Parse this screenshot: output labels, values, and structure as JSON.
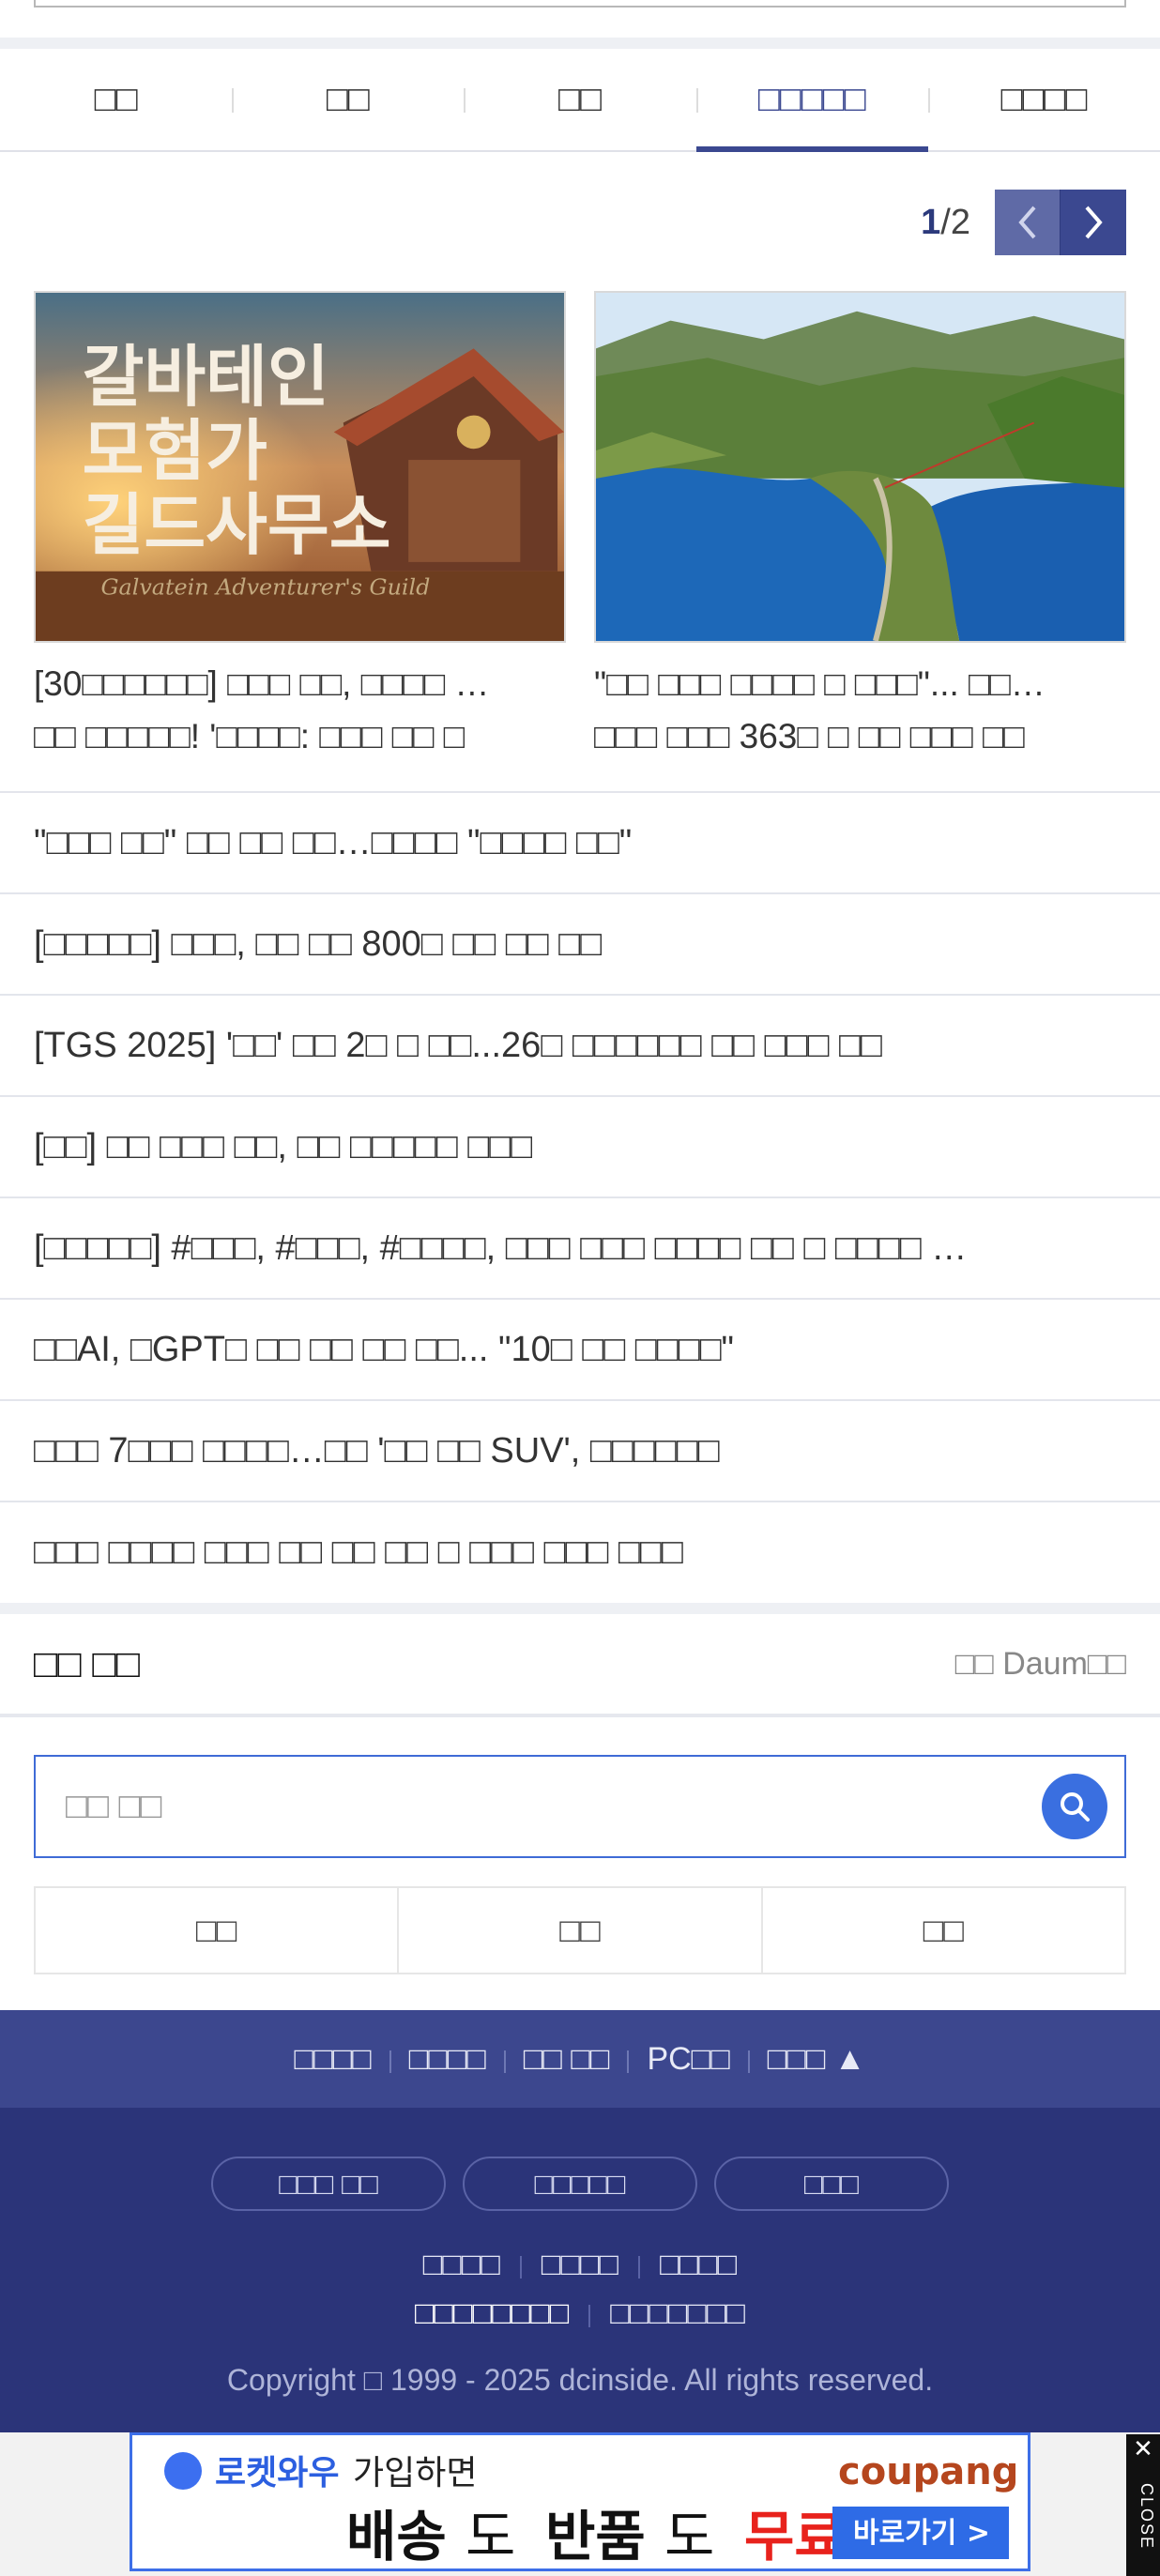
{
  "tabs": [
    {
      "label": "□□"
    },
    {
      "label": "□□"
    },
    {
      "label": "□□"
    },
    {
      "label": "□□□□□"
    },
    {
      "label": "□□□□"
    }
  ],
  "pager": {
    "current": "1",
    "total": "/2"
  },
  "cards": [
    {
      "title": "[30□□□□□□] □□□ □□, □□□□ …",
      "subtitle": "□□ □□□□□! '□□□□: □□□ □□ □",
      "image": {
        "text_lines": [
          "갈바테인",
          "모험가",
          "길드사무소"
        ],
        "script": "Galvatein Adventurer's Guild"
      }
    },
    {
      "title": "\"□□ □□□ □□□□ □ □□□\"... □□…",
      "subtitle": "□□□ □□□ 363□ □ □□ □□□ □□"
    }
  ],
  "list": [
    "\"□□□ □□\" □□ □□ □□…□□□□ \"□□□□ □□\"",
    "[□□□□□] □□□, □□ □□ 800□ □□ □□ □□",
    "[TGS 2025] '□□' □□ 2□ □ □□...26□ □□□□□□ □□ □□□ □□",
    "[□□] □□ □□□ □□, □□ □□□□□ □□□",
    "[□□□□□] #□□□, #□□□, #□□□□, □□□ □□□ □□□□ □□ □ □□□□ …",
    "□□AI, □GPT□ □□ □□ □□ □□... \"10□ □□ □□□□\"",
    "□□□ 7□□□ □□□□…□□ '□□ □□ SUV', □□□□□□",
    "□□□ □□□□ □□□ □□ □□ □□ □ □□□ □□□ □□□"
  ],
  "section": {
    "title": "□□ □□",
    "source": "□□ Daum□□"
  },
  "search": {
    "placeholder": "□□ □□"
  },
  "triple_buttons": [
    "□□",
    "□□",
    "□□"
  ],
  "footer_nav": [
    "□□□□",
    "□□□□",
    "□□ □□",
    "PC□□",
    "□□□ ▲"
  ],
  "footer_pills": [
    "□□□ □□",
    "□□□□□",
    "□□□"
  ],
  "footer_links_row1": [
    "□□□□",
    "□□□□",
    "□□□□"
  ],
  "footer_links_row2": [
    "□□□□□□□□",
    "□□□□□□□"
  ],
  "copyright": "Copyright □ 1999 - 2025 dcinside. All rights reserved.",
  "ad": {
    "line1_brand": "로켓와우",
    "line1_rest": " 가입하면",
    "logo": "coupang",
    "line2_a": "배송",
    "line2_b": "도 ",
    "line2_c": "반품",
    "line2_d": "도 ",
    "line2_e": "무료!",
    "cta": "바로가기 >",
    "close_x": "✕",
    "close_text": "CLOSE"
  },
  "colors": {
    "accent": "#3b4890",
    "footer_dark": "#2b3479",
    "search_border": "#3f6bd6",
    "ad_red": "#e8221c"
  }
}
